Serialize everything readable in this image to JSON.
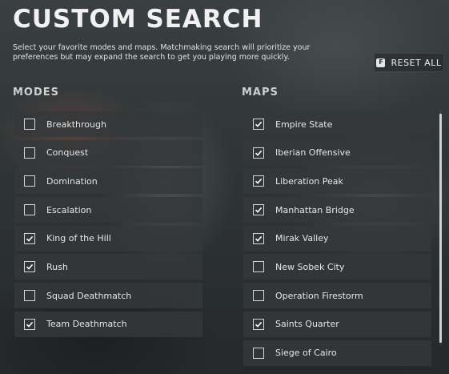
{
  "page": {
    "title": "CUSTOM SEARCH",
    "description": "Select your favorite modes and maps. Matchmaking search will prioritize your preferences but may expand the search to get you playing more quickly."
  },
  "reset": {
    "key": "F",
    "label": "RESET ALL"
  },
  "modes": {
    "title": "MODES",
    "items": [
      {
        "label": "Breakthrough",
        "checked": false
      },
      {
        "label": "Conquest",
        "checked": false
      },
      {
        "label": "Domination",
        "checked": false
      },
      {
        "label": "Escalation",
        "checked": false
      },
      {
        "label": "King of the Hill",
        "checked": true
      },
      {
        "label": "Rush",
        "checked": true
      },
      {
        "label": "Squad Deathmatch",
        "checked": false
      },
      {
        "label": "Team Deathmatch",
        "checked": true
      }
    ]
  },
  "maps": {
    "title": "MAPS",
    "items": [
      {
        "label": "Empire State",
        "checked": true
      },
      {
        "label": "Iberian Offensive",
        "checked": true
      },
      {
        "label": "Liberation Peak",
        "checked": true
      },
      {
        "label": "Manhattan Bridge",
        "checked": true
      },
      {
        "label": "Mirak Valley",
        "checked": true
      },
      {
        "label": "New Sobek City",
        "checked": false
      },
      {
        "label": "Operation Firestorm",
        "checked": false
      },
      {
        "label": "Saints Quarter",
        "checked": true
      },
      {
        "label": "Siege of Cairo",
        "checked": false
      }
    ]
  },
  "colors": {
    "text": "#e8e8e8",
    "row_background": "#34383a",
    "checkbox_border": "#d6d6d6"
  }
}
